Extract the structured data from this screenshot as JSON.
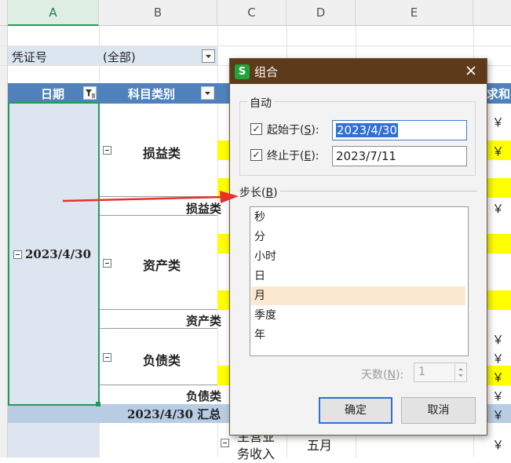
{
  "columns": [
    "A",
    "B",
    "C",
    "D",
    "E"
  ],
  "pivot": {
    "filter_label": "凭证号",
    "filter_value": "(全部)",
    "date_header": "日期",
    "category_header": "科目类别",
    "right_header_fragment": "求和",
    "date_value": "2023/4/30",
    "categories": [
      "损益类",
      "资产类",
      "负债类"
    ],
    "subtotals": [
      "损益类",
      "资产类",
      "负债类"
    ],
    "grand_total": "2023/4/30 汇总",
    "bottom_c": "主营业务收入",
    "bottom_c_line1": "主营业",
    "bottom_c_line2": "务收入",
    "bottom_d": "五月",
    "yen_symbol": "￥"
  },
  "dialog": {
    "title": "组合",
    "auto_label": "自动",
    "start_label": "起始于(S):",
    "start_pre": "起始于(",
    "start_key": "S",
    "start_post": "):",
    "start_checked": true,
    "start_value": "2023/4/30",
    "end_pre": "终止于(",
    "end_key": "E",
    "end_post": "):",
    "end_checked": true,
    "end_value": "2023/7/11",
    "step_pre": "步长(",
    "step_key": "B",
    "step_post": ")",
    "step_options": [
      "秒",
      "分",
      "小时",
      "日",
      "月",
      "季度",
      "年"
    ],
    "step_selected": "月",
    "days_pre": "天数(",
    "days_key": "N",
    "days_post": "):",
    "days_value": "1",
    "ok_label": "确定",
    "cancel_label": "取消"
  },
  "colors": {
    "title_bar": "#5d3a1a",
    "header_blue": "#4f81bd",
    "highlight_yellow": "#ffff00",
    "selection_green": "#1f9d55",
    "arrow_red": "#e8302a",
    "accent_blue": "#2f6fd6"
  },
  "icons": {
    "app_logo": "wps-s-logo-icon",
    "close": "close-icon",
    "filter": "filter-icon",
    "dropdown": "dropdown-arrow-icon",
    "collapse": "collapse-minus-icon",
    "spin": "spin-up-down-icon",
    "arrow": "red-arrow-annotation"
  }
}
